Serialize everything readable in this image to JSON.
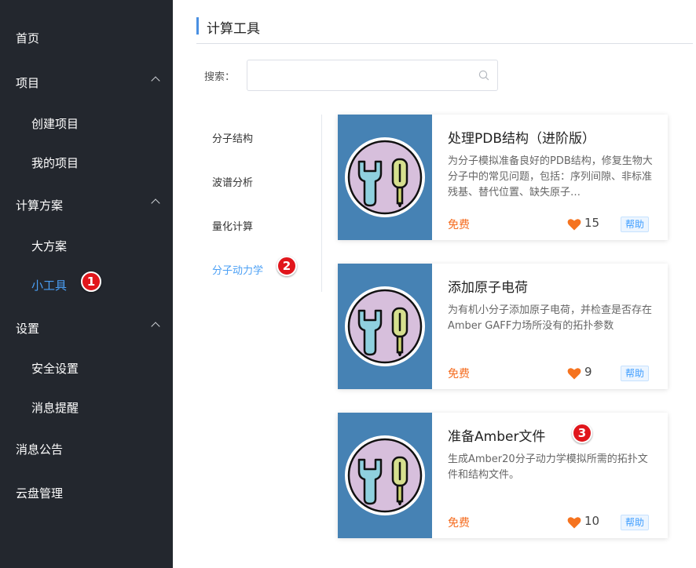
{
  "sidebar": {
    "items": [
      {
        "label": "首页"
      },
      {
        "label": "项目"
      },
      {
        "label": "创建项目"
      },
      {
        "label": "我的项目"
      },
      {
        "label": "计算方案"
      },
      {
        "label": "大方案"
      },
      {
        "label": "小工具"
      },
      {
        "label": "设置"
      },
      {
        "label": "安全设置"
      },
      {
        "label": "消息提醒"
      },
      {
        "label": "消息公告"
      },
      {
        "label": "云盘管理"
      }
    ]
  },
  "page": {
    "title": "计算工具"
  },
  "search": {
    "label": "搜索：",
    "value": "",
    "placeholder": ""
  },
  "categories": [
    {
      "label": "分子结构"
    },
    {
      "label": "波谱分析"
    },
    {
      "label": "量化计算"
    },
    {
      "label": "分子动力学"
    }
  ],
  "cards": [
    {
      "title": "处理PDB结构（进阶版）",
      "desc": "为分子模拟准备良好的PDB结构，修复生物大分子中的常见问题，包括：序列间隙、非标准残基、替代位置、缺失原子…",
      "price": "免费",
      "likes": "15",
      "help": "帮助"
    },
    {
      "title": "添加原子电荷",
      "desc": "为有机小分子添加原子电荷，并检查是否存在Amber GAFF力场所没有的拓扑参数",
      "price": "免费",
      "likes": "9",
      "help": "帮助"
    },
    {
      "title": "准备Amber文件",
      "desc": "生成Amber20分子动力学模拟所需的拓扑文件和结构文件。",
      "price": "免费",
      "likes": "10",
      "help": "帮助"
    }
  ],
  "annotations": [
    "1",
    "2",
    "3"
  ],
  "colors": {
    "sidebar_bg": "#23272e",
    "active": "#4a9ff5",
    "price": "#f56c1f",
    "thumb_bg": "#4682b4",
    "heart": "#f5731f",
    "badge": "#e1161c"
  },
  "icons": {
    "search": "search-icon",
    "expand": "chevron-up-icon",
    "tool": "wrench-screwdriver-icon",
    "like": "heart-icon"
  }
}
